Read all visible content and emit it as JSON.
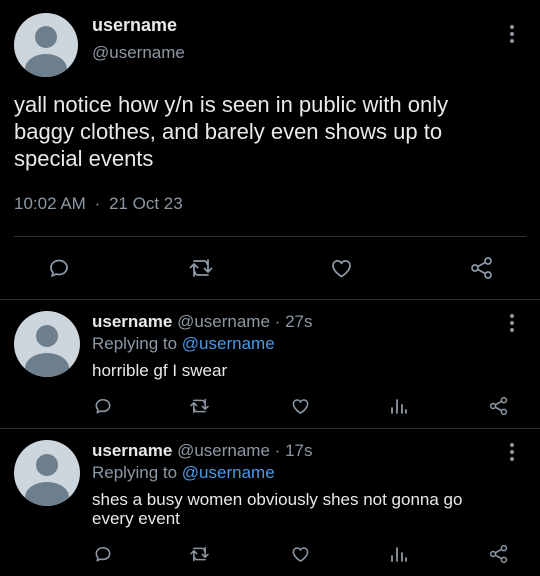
{
  "main_tweet": {
    "display_name": "username",
    "handle": "@username",
    "text_lines": [
      "yall notice how y/n is seen in public with only",
      "baggy clothes, and barely even shows up to",
      "special events"
    ],
    "time": "10:02 AM",
    "separator": "·",
    "date": "21 Oct 23",
    "icons": [
      "reply-icon",
      "retweet-icon",
      "like-icon",
      "share-icon"
    ]
  },
  "replies": [
    {
      "display_name": "username",
      "handle": "@username",
      "separator": "·",
      "age": "27s",
      "replying_prefix": "Replying to",
      "replying_to": "@username",
      "text_lines": [
        "horrible gf I swear"
      ]
    },
    {
      "display_name": "username",
      "handle": "@username",
      "separator": "·",
      "age": "17s",
      "replying_prefix": "Replying to",
      "replying_to": "@username",
      "text_lines": [
        "shes a busy women obviously shes not gonna go",
        "every event"
      ]
    }
  ],
  "colors": {
    "background": "#000000",
    "text": "#e7e9ea",
    "secondary": "#8b98a5",
    "link": "#4a99e9",
    "divider": "#2f3336"
  }
}
